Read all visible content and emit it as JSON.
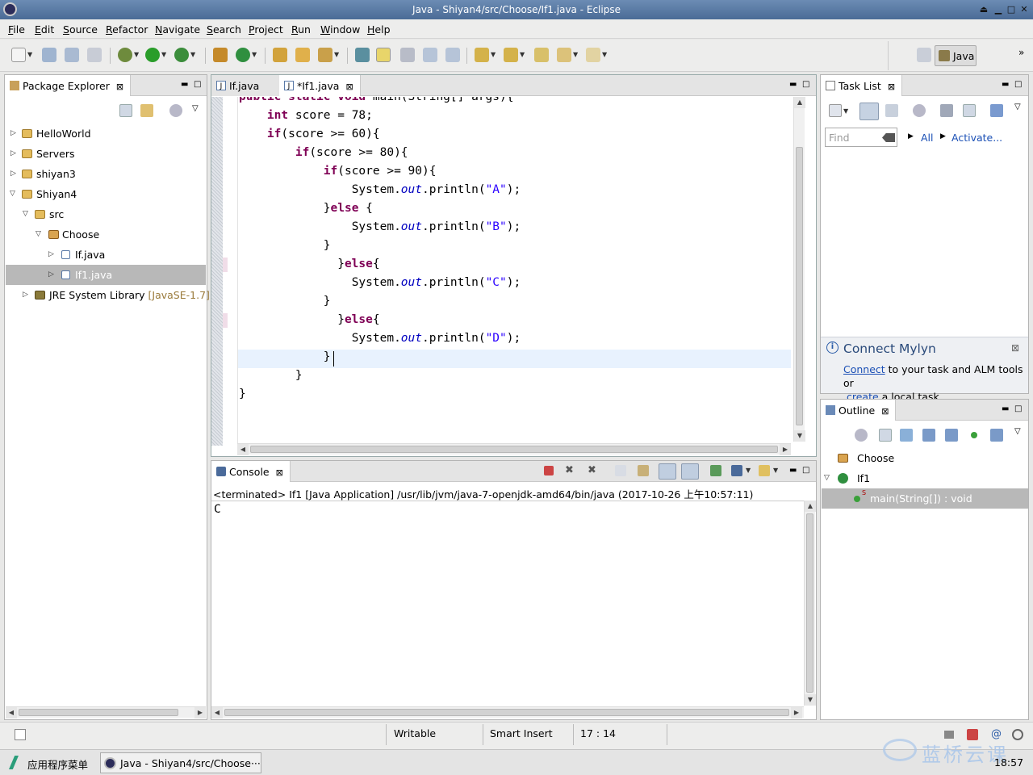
{
  "window": {
    "title": "Java - Shiyan4/src/Choose/If1.java - Eclipse"
  },
  "menu": [
    "File",
    "Edit",
    "Source",
    "Refactor",
    "Navigate",
    "Search",
    "Project",
    "Run",
    "Window",
    "Help"
  ],
  "perspective": {
    "label": "Java"
  },
  "package_explorer": {
    "title": "Package Explorer",
    "items": [
      {
        "label": "HelloWorld"
      },
      {
        "label": "Servers"
      },
      {
        "label": "shiyan3"
      },
      {
        "label": "Shiyan4"
      },
      {
        "label": "src"
      },
      {
        "label": "Choose"
      },
      {
        "label": "If.java"
      },
      {
        "label": "If1.java"
      },
      {
        "label": "JRE System Library",
        "suffix": "[JavaSE-1.7]"
      }
    ]
  },
  "editor": {
    "tabs": [
      {
        "label": "If.java"
      },
      {
        "label": "*If1.java"
      }
    ],
    "lines": [
      {
        "indent": "",
        "parts": [
          {
            "t": "public static void",
            "c": "kw"
          },
          {
            "t": " main(String[] args){",
            "c": ""
          }
        ]
      },
      {
        "indent": "    ",
        "parts": [
          {
            "t": "int",
            "c": "kw"
          },
          {
            "t": " score = 78;",
            "c": ""
          }
        ]
      },
      {
        "indent": "    ",
        "parts": [
          {
            "t": "if",
            "c": "kw"
          },
          {
            "t": "(score >= 60){",
            "c": ""
          }
        ]
      },
      {
        "indent": "        ",
        "parts": [
          {
            "t": "if",
            "c": "kw"
          },
          {
            "t": "(score >= 80){",
            "c": ""
          }
        ]
      },
      {
        "indent": "            ",
        "parts": [
          {
            "t": "if",
            "c": "kw"
          },
          {
            "t": "(score >= 90){",
            "c": ""
          }
        ]
      },
      {
        "indent": "                ",
        "parts": [
          {
            "t": "System.",
            "c": ""
          },
          {
            "t": "out",
            "c": "fld"
          },
          {
            "t": ".println(",
            "c": ""
          },
          {
            "t": "\"A\"",
            "c": "str"
          },
          {
            "t": ");",
            "c": ""
          }
        ]
      },
      {
        "indent": "            ",
        "parts": [
          {
            "t": "}",
            "c": ""
          },
          {
            "t": "else",
            "c": "kw"
          },
          {
            "t": " {",
            "c": ""
          }
        ]
      },
      {
        "indent": "                ",
        "parts": [
          {
            "t": "System.",
            "c": ""
          },
          {
            "t": "out",
            "c": "fld"
          },
          {
            "t": ".println(",
            "c": ""
          },
          {
            "t": "\"B\"",
            "c": "str"
          },
          {
            "t": ");",
            "c": ""
          }
        ]
      },
      {
        "indent": "            ",
        "parts": [
          {
            "t": "}",
            "c": ""
          }
        ]
      },
      {
        "indent": "              ",
        "parts": [
          {
            "t": "}",
            "c": ""
          },
          {
            "t": "else",
            "c": "kw"
          },
          {
            "t": "{",
            "c": ""
          }
        ]
      },
      {
        "indent": "                ",
        "parts": [
          {
            "t": "System.",
            "c": ""
          },
          {
            "t": "out",
            "c": "fld"
          },
          {
            "t": ".println(",
            "c": ""
          },
          {
            "t": "\"C\"",
            "c": "str"
          },
          {
            "t": ");",
            "c": ""
          }
        ]
      },
      {
        "indent": "            ",
        "parts": [
          {
            "t": "}",
            "c": ""
          }
        ]
      },
      {
        "indent": "              ",
        "parts": [
          {
            "t": "}",
            "c": ""
          },
          {
            "t": "else",
            "c": "kw"
          },
          {
            "t": "{",
            "c": ""
          }
        ]
      },
      {
        "indent": "                ",
        "parts": [
          {
            "t": "System.",
            "c": ""
          },
          {
            "t": "out",
            "c": "fld"
          },
          {
            "t": ".println(",
            "c": ""
          },
          {
            "t": "\"D\"",
            "c": "str"
          },
          {
            "t": ");",
            "c": ""
          }
        ]
      },
      {
        "indent": "            ",
        "parts": [
          {
            "t": "}",
            "c": ""
          }
        ]
      },
      {
        "indent": "        ",
        "parts": [
          {
            "t": "}",
            "c": ""
          }
        ]
      },
      {
        "indent": "",
        "parts": [
          {
            "t": "}",
            "c": ""
          }
        ]
      }
    ]
  },
  "console": {
    "title": "Console",
    "status": "<terminated> If1 [Java Application] /usr/lib/jvm/java-7-openjdk-amd64/bin/java (2017-10-26 上午10:57:11)",
    "output": "C"
  },
  "task_list": {
    "title": "Task List",
    "find_placeholder": "Find",
    "all_label": "All",
    "activate_label": "Activate...",
    "mylyn_title": "Connect Mylyn",
    "mylyn_connect": "Connect",
    "mylyn_text1": " to your task and ALM tools or",
    "mylyn_create": "create",
    "mylyn_text2": " a local task."
  },
  "outline": {
    "title": "Outline",
    "items": [
      {
        "label": "Choose"
      },
      {
        "label": "If1"
      },
      {
        "label": "main(String[]) : void"
      }
    ]
  },
  "status": {
    "writable": "Writable",
    "insert_mode": "Smart Insert",
    "position": "17 : 14"
  },
  "taskbar": {
    "menu_label": "应用程序菜单",
    "window_label": "Java - Shiyan4/src/Choose···",
    "clock": "18:57",
    "watermark": "蓝桥云课"
  },
  "colors": {
    "keyword": "#7f0055",
    "string": "#2a00ff",
    "field": "#0000c0",
    "link": "#1a4fb5",
    "selection": "#b8b8b8"
  }
}
